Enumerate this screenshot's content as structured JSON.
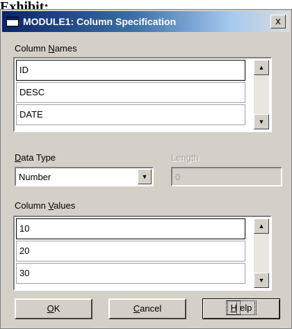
{
  "page": {
    "heading": "Exhibit:"
  },
  "window": {
    "title": "MODULE1: Column Specification",
    "close_glyph": "x"
  },
  "column_names": {
    "label_pre": "Column ",
    "label_accel": "N",
    "label_post": "ames",
    "rows": [
      "ID",
      "DESC",
      "DATE"
    ]
  },
  "data_type": {
    "label_accel": "D",
    "label_post": "ata Type",
    "selected": "Number"
  },
  "length": {
    "label": "Length",
    "value": "0"
  },
  "column_values": {
    "label_pre": "Column ",
    "label_accel": "V",
    "label_post": "alues",
    "rows": [
      "10",
      "20",
      "30"
    ]
  },
  "buttons": {
    "ok_accel": "O",
    "ok_post": "K",
    "cancel_accel": "C",
    "cancel_post": "ancel",
    "help_accel": "H",
    "help_post": "elp"
  },
  "icons": {
    "arrow_up": "▲",
    "arrow_down": "▼"
  }
}
